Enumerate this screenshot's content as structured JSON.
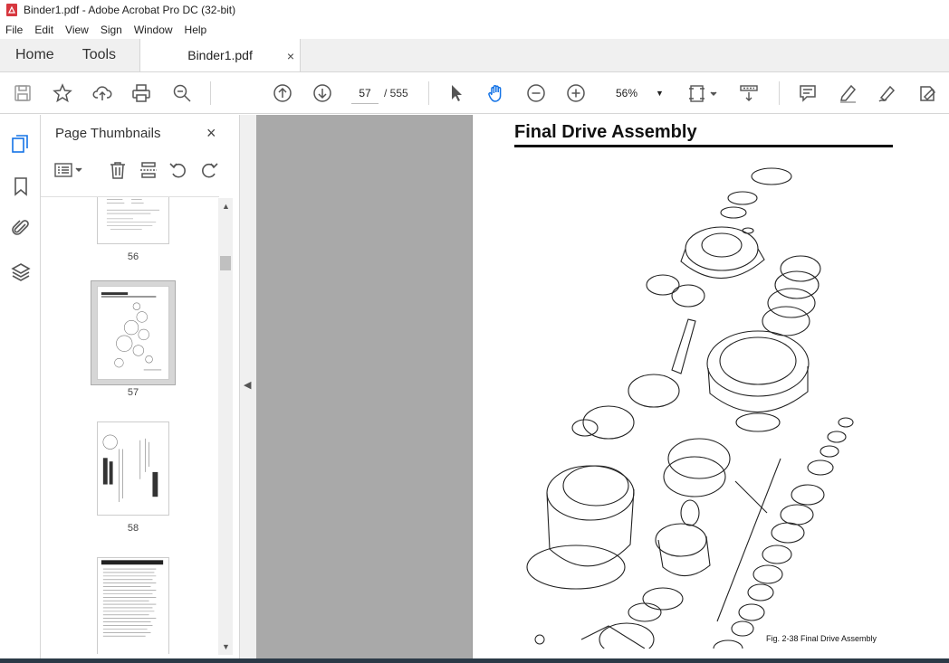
{
  "window": {
    "title": "Binder1.pdf - Adobe Acrobat Pro DC (32-bit)"
  },
  "menu": [
    "File",
    "Edit",
    "View",
    "Sign",
    "Window",
    "Help"
  ],
  "tabs": {
    "home": "Home",
    "tools": "Tools",
    "document": "Binder1.pdf",
    "close": "×"
  },
  "toolbar": {
    "current_page": "57",
    "total_pages": "/ 555",
    "zoom": "56%",
    "icons": [
      "save-icon",
      "bookmark-star-icon",
      "upload-icon",
      "print-icon",
      "search-zoom-icon",
      "page-up-icon",
      "page-down-icon",
      "select-cursor-icon",
      "hand-icon",
      "zoom-out-icon",
      "zoom-in-icon",
      "fit-page-icon",
      "scroll-mode-icon",
      "comment-icon",
      "highlight-icon",
      "sign-icon",
      "fill-sign-icon"
    ]
  },
  "rail": {
    "icons": [
      "page-thumbnails-icon",
      "bookmarks-icon",
      "attachments-icon",
      "layers-icon"
    ]
  },
  "panel": {
    "title": "Page Thumbnails",
    "close": "×",
    "thumbnails": [
      {
        "label": "56"
      },
      {
        "label": "57",
        "selected": true
      },
      {
        "label": "58"
      },
      {
        "label": ""
      }
    ]
  },
  "page": {
    "title": "Final Drive Assembly",
    "caption": "Fig. 2-38  Final Drive Assembly"
  }
}
